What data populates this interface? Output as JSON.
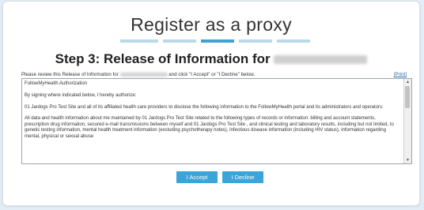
{
  "header": {
    "title": "Register as a proxy",
    "subtitle_prefix": "Step 3: Release of Information for"
  },
  "steps": {
    "count": 5,
    "active_index": 2
  },
  "instructions": {
    "before": "Please review this Release of Information for",
    "after": "and click \"I Accept\" or \"I Decline\" below."
  },
  "print_label": "[Print]",
  "document": {
    "heading": "FollowMyHealth Authorization",
    "para1": "By signing where indicated below, I hereby authorize:",
    "para2": "01 Jardogs Pro Test Site and all of its affiliated health care providers to disclose the following information to the FollowMyHealth portal and its administrators and operators:",
    "para3": "All data and health information about me maintained by 01 Jardogs Pro Test Site related to the following types of records or information: billing and account statements, prescription drug information, secured e-mail transmissions between myself and 01 Jardogs Pro Test Site , and clinical testing and laboratory results, including but not limited, to genetic testing information, mental health treatment information (excluding psychotherapy notes), infectious disease information (including HIV status), information regarding mental, physical or sexual abuse"
  },
  "buttons": {
    "accept": "I Accept",
    "decline": "I Decline"
  },
  "colors": {
    "accent": "#3ba4d8",
    "step_active": "#3fa3d2",
    "step_inactive": "#b8d9ea",
    "page_bg": "#e3edf5"
  }
}
